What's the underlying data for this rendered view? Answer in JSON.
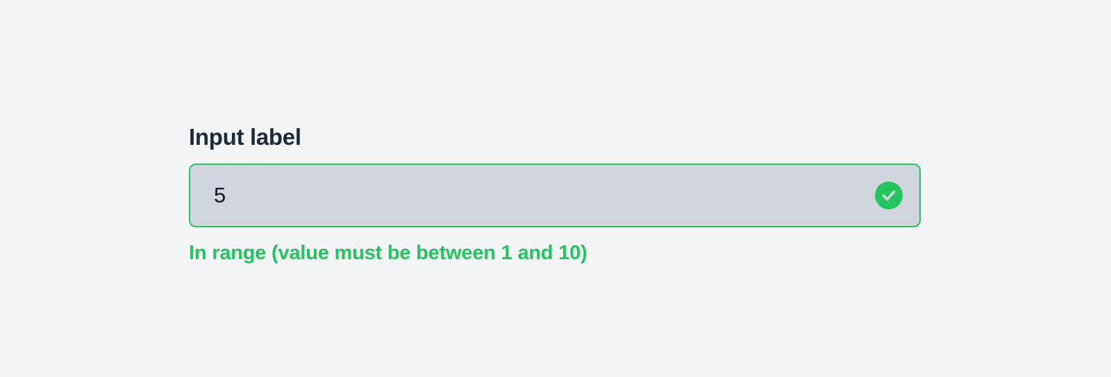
{
  "field": {
    "label": "Input label",
    "value": "5",
    "validation_message": "In range (value must be between 1 and 10)",
    "status": "valid",
    "status_icon": "check-circle-icon"
  },
  "colors": {
    "background": "#f2f4f6",
    "label_text": "#1f2a37",
    "input_fill": "#d1d5dc",
    "success": "#22c55e"
  }
}
